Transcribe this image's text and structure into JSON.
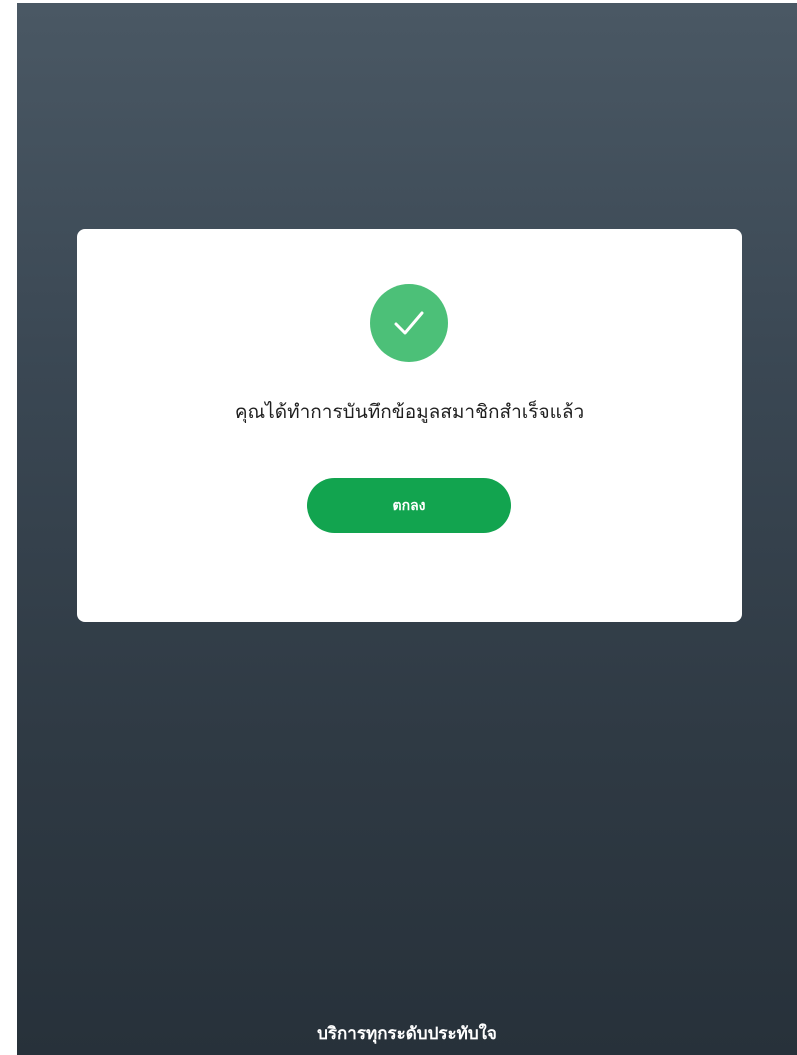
{
  "dialog": {
    "icon": "checkmark-icon",
    "message": "คุณได้ทำการบันทึกข้อมูลสมาชิกสำเร็จแล้ว",
    "ok_label": "ตกลง"
  },
  "footer": {
    "slogan": "บริการทุกระดับประทับใจ"
  },
  "colors": {
    "success_green": "#4cc078",
    "button_green": "#12a44f",
    "background_top": "#4a5864",
    "background_bottom": "#27313a"
  }
}
